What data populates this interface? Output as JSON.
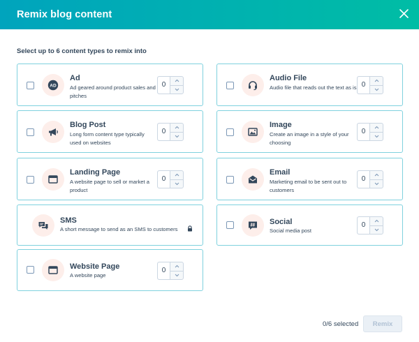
{
  "dialog": {
    "title": "Remix blog content",
    "instruction": "Select up to 6 content types to remix into"
  },
  "content_types": [
    {
      "title": "Ad",
      "description": "Ad geared around product sales and pitches",
      "icon": "ad-badge-icon",
      "count": "0",
      "checked": false
    },
    {
      "title": "Audio File",
      "description": "Audio file that reads out the text as is",
      "icon": "headset-icon",
      "count": "0",
      "checked": false
    },
    {
      "title": "Blog Post",
      "description": "Long form content type typically used on websites",
      "icon": "megaphone-icon",
      "count": "0",
      "checked": false
    },
    {
      "title": "Image",
      "description": "Create an image in a style of your choosing",
      "icon": "image-icon",
      "count": "0",
      "checked": false
    },
    {
      "title": "Landing Page",
      "description": "A website page to sell or market a product",
      "icon": "browser-window-icon",
      "count": "0",
      "checked": false
    },
    {
      "title": "Email",
      "description": "Marketing email to be sent out to customers",
      "icon": "envelope-icon",
      "count": "0",
      "checked": false
    },
    {
      "title": "SMS",
      "description": "A short message to send as an SMS to customers",
      "icon": "chat-bubbles-icon",
      "locked": true
    },
    {
      "title": "Social",
      "description": "Social media post",
      "icon": "hashtag-chat-icon",
      "count": "0",
      "checked": false
    },
    {
      "title": "Website Page",
      "description": "A website page",
      "icon": "browser-window-icon",
      "count": "0",
      "checked": false
    }
  ],
  "footer": {
    "selected_count": "0/6 selected",
    "remix_label": "Remix"
  },
  "colors": {
    "header_gradient_start": "#00a4bd",
    "header_gradient_end": "#00bda5",
    "card_border": "#7fd1de",
    "icon_background": "#fdeeea",
    "text": "#33475b"
  }
}
